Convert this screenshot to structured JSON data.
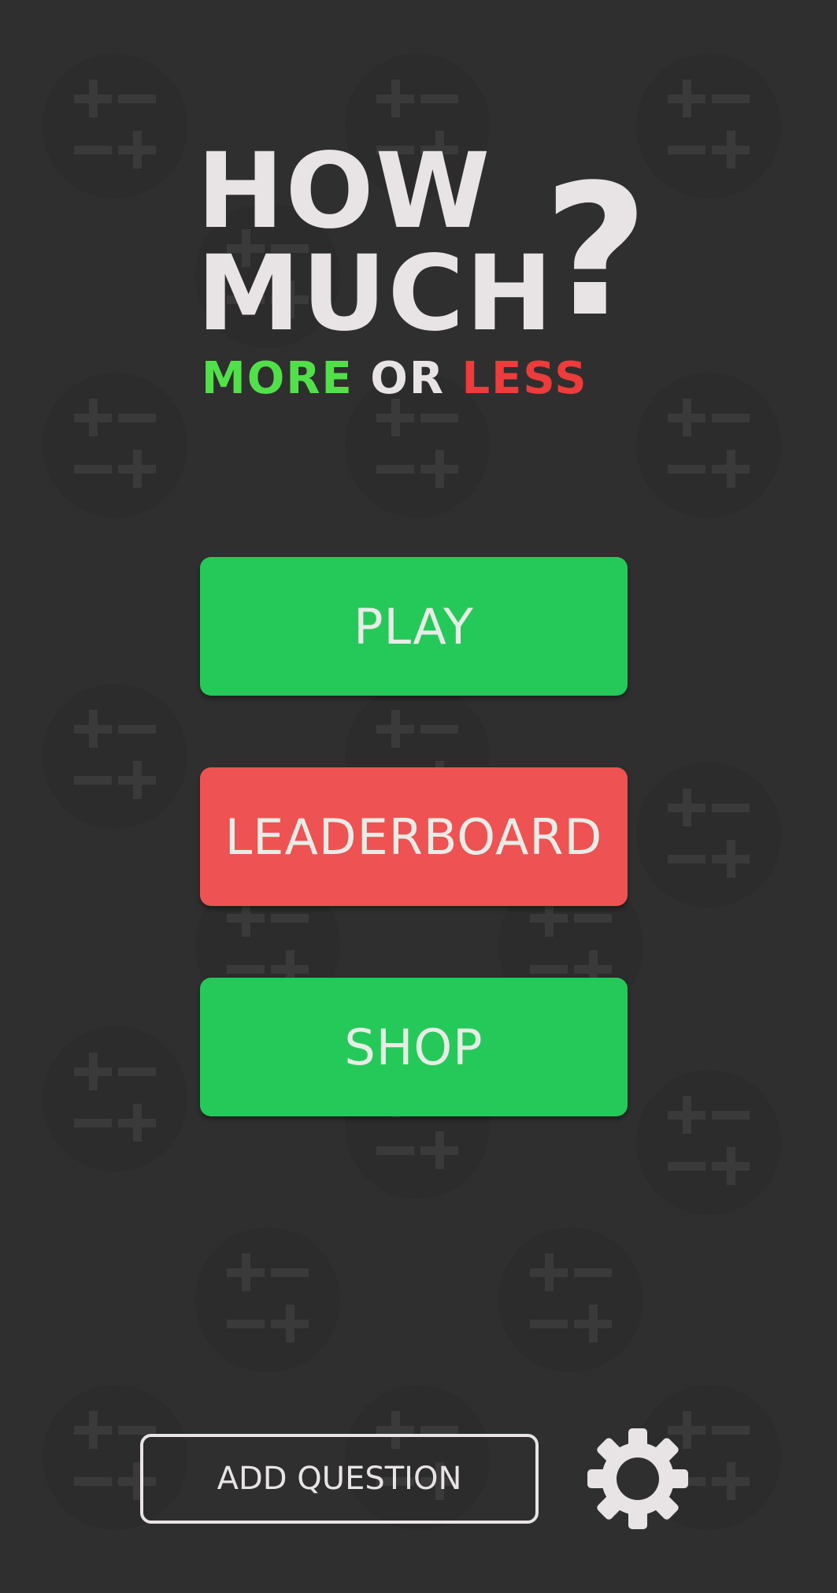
{
  "logo": {
    "line1": "HOW",
    "line2": "MUCH",
    "question_mark": "?",
    "subtitle_more": "MORE",
    "subtitle_or": "OR",
    "subtitle_less": "LESS"
  },
  "menu": {
    "play_label": "PLAY",
    "leaderboard_label": "LEADERBOARD",
    "shop_label": "SHOP"
  },
  "footer": {
    "add_question_label": "ADD QUESTION",
    "settings_icon": "gear-icon"
  },
  "colors": {
    "background": "#2f2f2f",
    "green": "#25c95a",
    "red": "#ee5252",
    "text_light": "#e8e4e5",
    "subtitle_green": "#52e04a",
    "subtitle_red": "#ee3b3b"
  }
}
